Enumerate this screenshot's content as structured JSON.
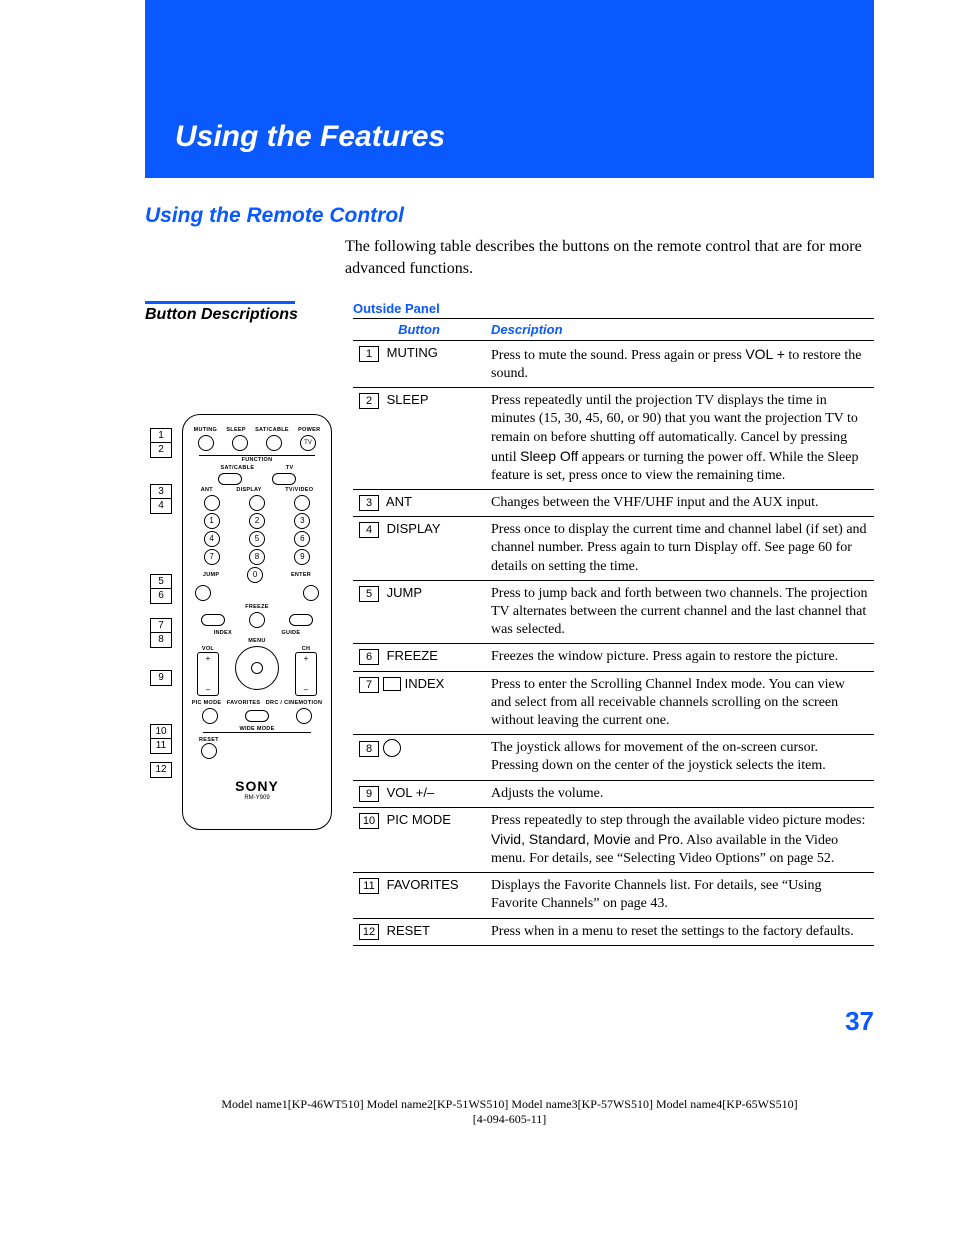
{
  "banner": "Using the Features",
  "section": "Using the Remote Control",
  "intro": "The following table describes the buttons on the remote control that are for more advanced functions.",
  "side_heading": "Button Descriptions",
  "table_title": "Outside Panel",
  "headers": {
    "button": "Button",
    "description": "Description"
  },
  "rows": [
    {
      "num": "1",
      "button": "MUTING",
      "desc_pre": "Press to mute the sound. Press again or press ",
      "desc_sans": "VOL +",
      "desc_post": " to restore the sound."
    },
    {
      "num": "2",
      "button": "SLEEP",
      "desc_pre": "Press repeatedly until the projection TV displays the time in minutes (15, 30, 45, 60, or 90) that you want the projection TV to remain on before shutting off automatically. Cancel by pressing until ",
      "desc_sans": "Sleep Off",
      "desc_post": " appears or turning the power off. While the Sleep feature is set, press once to view the remaining time."
    },
    {
      "num": "3",
      "button": "ANT",
      "desc": "Changes between the VHF/UHF input and the AUX input."
    },
    {
      "num": "4",
      "button": "DISPLAY",
      "desc": "Press once to display the current time and channel label (if set) and channel number. Press again to turn Display off. See page 60 for details on setting the time."
    },
    {
      "num": "5",
      "button": "JUMP",
      "desc": "Press to jump back and forth between two channels. The projection TV alternates between the current channel and the last channel that was selected."
    },
    {
      "num": "6",
      "button": "FREEZE",
      "desc": "Freezes the window picture. Press again to restore the picture."
    },
    {
      "num": "7",
      "button": "INDEX",
      "icon": "index-icon",
      "desc": "Press to enter the Scrolling Channel Index mode. You can view and select from all receivable channels scrolling on the screen without leaving the current one."
    },
    {
      "num": "8",
      "button": "",
      "icon": "joystick-icon",
      "desc": "The joystick allows for movement of the on-screen cursor. Pressing down on the center of the joystick selects the item."
    },
    {
      "num": "9",
      "button": "VOL +/–",
      "desc": "Adjusts the volume."
    },
    {
      "num": "10",
      "button": "PIC MODE",
      "desc_pre": "Press repeatedly to step through the available video picture modes: ",
      "desc_sans": "Vivid, Standard, Movie",
      "desc_mid": " and ",
      "desc_sans2": "Pro",
      "desc_post": ". Also available in the Video menu. For details, see “Selecting Video Options” on page 52."
    },
    {
      "num": "11",
      "button": "FAVORITES",
      "desc": "Displays the Favorite Channels list. For details, see “Using Favorite Channels” on page 43."
    },
    {
      "num": "12",
      "button": "RESET",
      "desc": "Press when in a menu to reset the settings to the factory defaults."
    }
  ],
  "callouts": [
    "1",
    "2",
    "3",
    "4",
    "5",
    "6",
    "7",
    "8",
    "9",
    "10",
    "11",
    "12"
  ],
  "callout_tops": [
    14,
    28,
    70,
    84,
    160,
    174,
    204,
    218,
    256,
    310,
    324,
    348
  ],
  "remote": {
    "top_labels": [
      "MUTING",
      "SLEEP",
      "SAT/CABLE",
      "POWER"
    ],
    "tv_label": "TV",
    "function": "FUNCTION",
    "sat": "SAT/CABLE",
    "tv": "TV",
    "ant": "ANT",
    "display": "DISPLAY",
    "tvvideo": "TV/VIDEO",
    "jump": "JUMP",
    "enter": "ENTER",
    "freeze": "FREEZE",
    "index": "INDEX",
    "guide": "GUIDE",
    "menu": "MENU",
    "vol": "VOL",
    "ch": "CH",
    "pic": "PIC MODE",
    "fav": "FAVORITES",
    "drc": "DRC / CINEMOTION",
    "wide": "WIDE MODE",
    "reset": "RESET",
    "brand": "SONY",
    "model": "RM-Y909"
  },
  "page_number": "37",
  "footer_line1": "Model name1[KP-46WT510]  Model name2[KP-51WS510]  Model name3[KP-57WS510]  Model name4[KP-65WS510]",
  "footer_line2": "[4-094-605-11]"
}
